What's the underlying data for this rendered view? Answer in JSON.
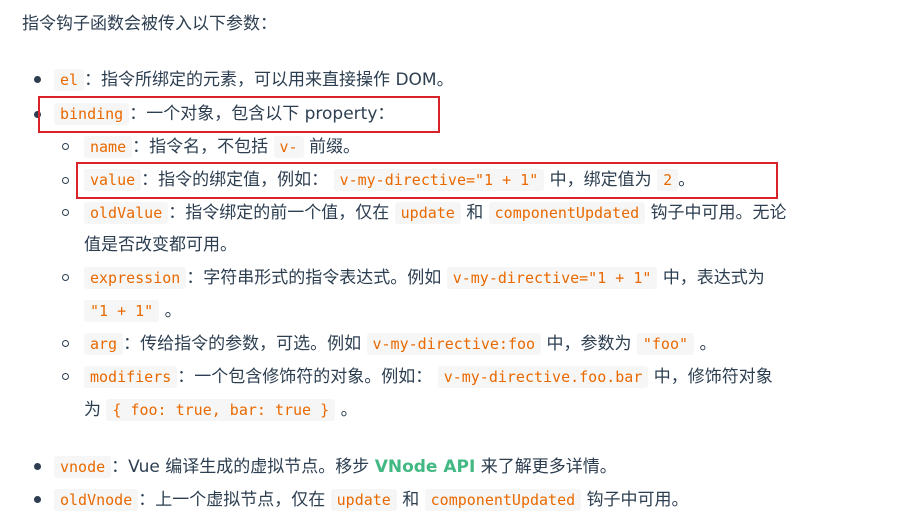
{
  "intro": "指令钩子函数会被传入以下参数：",
  "items": {
    "el": {
      "code": "el",
      "text": "：指令所绑定的元素，可以用来直接操作 DOM。"
    },
    "binding": {
      "code": "binding",
      "text": "：一个对象，包含以下 property："
    },
    "name": {
      "code": "name",
      "text1": "：指令名，不包括",
      "code2": "v-",
      "text2": "前缀。"
    },
    "value": {
      "code": "value",
      "text1": "：指令的绑定值，例如：",
      "code2": "v-my-directive=\"1 + 1\"",
      "text2": "中，绑定值为",
      "code3": "2",
      "text3": "。"
    },
    "oldValue": {
      "code": "oldValue",
      "text1": "：指令绑定的前一个值，仅在",
      "code2": "update",
      "text2": "和",
      "code3": "componentUpdated",
      "text3": "钩子中可用。无论",
      "text4": "值是否改变都可用。"
    },
    "expression": {
      "code": "expression",
      "text1": "：字符串形式的指令表达式。例如",
      "code2": "v-my-directive=\"1 + 1\"",
      "text2": "中，表达式为",
      "code3": "\"1 + 1\"",
      "text3": "。"
    },
    "arg": {
      "code": "arg",
      "text1": "：传给指令的参数，可选。例如",
      "code2": "v-my-directive:foo",
      "text2": "中，参数为",
      "code3": "\"foo\"",
      "text3": "。"
    },
    "modifiers": {
      "code": "modifiers",
      "text1": "：一个包含修饰符的对象。例如：",
      "code2": "v-my-directive.foo.bar",
      "text2": "中，修饰符对象",
      "text3": "为",
      "code3": "{ foo: true, bar: true }",
      "text4": "。"
    },
    "vnode": {
      "code": "vnode",
      "text1": "：Vue 编译生成的虚拟节点。移步",
      "link": "VNode API",
      "text2": "来了解更多详情。"
    },
    "oldVnode": {
      "code": "oldVnode",
      "text1": "：上一个虚拟节点，仅在",
      "code2": "update",
      "text2": "和",
      "code3": "componentUpdated",
      "text3": "钩子中可用。"
    }
  },
  "colors": {
    "highlight_box": "#d9232b",
    "code_text": "#e96900",
    "link": "#42b983"
  }
}
